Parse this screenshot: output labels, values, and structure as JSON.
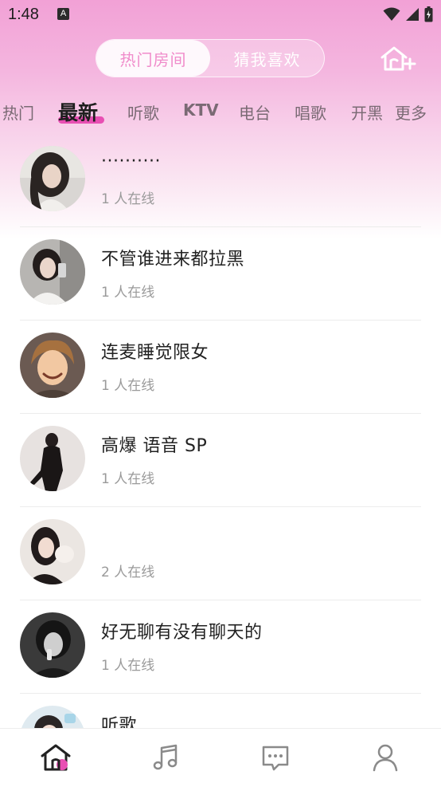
{
  "status_bar": {
    "time": "1:48",
    "notification_glyph": "A",
    "icons": [
      "wifi-icon",
      "signal-icon",
      "battery-icon"
    ]
  },
  "header": {
    "segments": [
      {
        "label": "热门房间",
        "active": true
      },
      {
        "label": "猜我喜欢",
        "active": false
      }
    ],
    "create_room_icon": "home-plus-icon"
  },
  "category_tabs": [
    {
      "label": "热门",
      "active": false
    },
    {
      "label": "最新",
      "active": true
    },
    {
      "label": "听歌",
      "active": false
    },
    {
      "label": "KTV",
      "active": false
    },
    {
      "label": "电台",
      "active": false
    },
    {
      "label": "唱歌",
      "active": false
    },
    {
      "label": "开黑",
      "active": false
    },
    {
      "label": "更多",
      "active": false
    }
  ],
  "rooms": [
    {
      "title": "··········",
      "online": "1 人在线"
    },
    {
      "title": "不管谁进来都拉黑",
      "online": "1 人在线"
    },
    {
      "title": "连麦睡觉限女",
      "online": "1 人在线"
    },
    {
      "title": "高爆  语音  SP",
      "online": "1 人在线"
    },
    {
      "title": "",
      "online": "2 人在线"
    },
    {
      "title": "好无聊有没有聊天的",
      "online": "1 人在线"
    },
    {
      "title": "听歌",
      "online": ""
    }
  ],
  "bottom_nav": [
    {
      "icon": "home-icon",
      "active": true
    },
    {
      "icon": "music-icon",
      "active": false
    },
    {
      "icon": "message-icon",
      "active": false
    },
    {
      "icon": "profile-icon",
      "active": false
    }
  ],
  "colors": {
    "accent_pink": "#e84fb3",
    "segment_active_text": "#f08ccb",
    "header_gradient_top": "#f2a1d6"
  }
}
